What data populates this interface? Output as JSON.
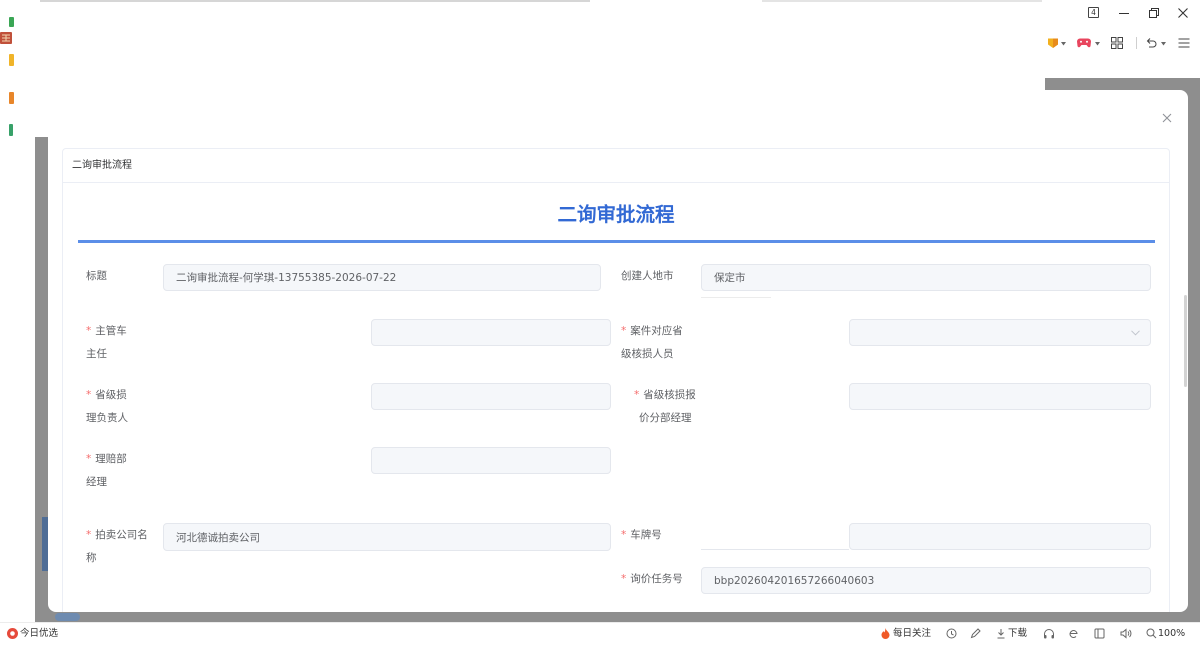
{
  "theme": {
    "accent_blue": "#3269d4",
    "rule_blue": "#5b8ee8",
    "required_red": "#f56c6c",
    "backdrop_gray": "#8e8e8e"
  },
  "browser": {
    "tab_count": "4",
    "window_control_icons": [
      "minimize-icon",
      "restore-icon",
      "close-icon"
    ],
    "toolbar_icons": [
      "extension-icon",
      "gamepad-icon",
      "grid-icon",
      "undo-icon",
      "menu-icon"
    ]
  },
  "modal": {
    "card_header": "二询审批流程",
    "form_title": "二询审批流程",
    "required_mark": "*",
    "fields": [
      {
        "label_lines": [
          "标题"
        ],
        "required": false,
        "value": "二询审批流程-何学琪-13755385-2026-07-22"
      },
      {
        "label_lines": [
          "创建人地市"
        ],
        "required": false,
        "value": "保定市"
      },
      {
        "label_lines": [
          "主管车",
          "主任"
        ],
        "required": true,
        "value": ""
      },
      {
        "label_lines": [
          "案件对应省",
          "级核损人员"
        ],
        "required": true,
        "value": "",
        "control_icon": "chevron-down-icon"
      },
      {
        "label_lines": [
          "省级损",
          "理负责人"
        ],
        "required": true,
        "value": ""
      },
      {
        "label_lines": [
          "省级核损报",
          "价分部经理"
        ],
        "required": true,
        "value": ""
      },
      {
        "label_lines": [
          "理赔部",
          "经理"
        ],
        "required": true,
        "value": ""
      },
      {
        "label_lines": [
          "拍卖公司名",
          "称"
        ],
        "required": true,
        "value": "河北德诚拍卖公司"
      },
      {
        "label_lines": [
          "车牌号"
        ],
        "required": true,
        "value": ""
      },
      {
        "label_lines": [
          "询价任务号"
        ],
        "required": true,
        "value": "bbp202604201657266040603"
      }
    ]
  },
  "status_bar": {
    "left_label": "今日优选",
    "daily_follow": "每日关注",
    "download": "下载",
    "zoom": "100%",
    "icons": [
      "today-pick-icon",
      "fire-icon",
      "refresh-icon",
      "pen-icon",
      "download-icon",
      "headset-icon",
      "browser-e-icon",
      "window-icon",
      "speaker-icon",
      "zoom-icon"
    ]
  }
}
